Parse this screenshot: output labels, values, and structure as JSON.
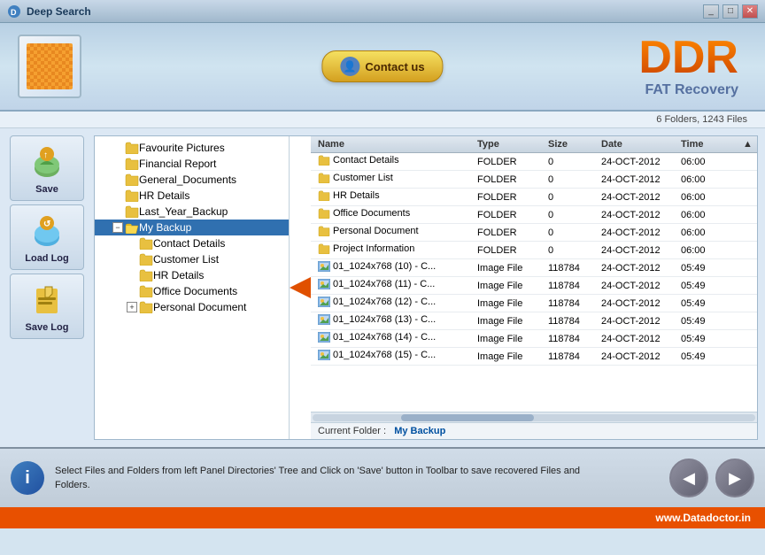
{
  "window": {
    "title": "Deep Search"
  },
  "header": {
    "contact_btn": "Contact us",
    "brand_ddr": "DDR",
    "brand_sub": "FAT Recovery"
  },
  "info_bar": {
    "text": "6 Folders, 1243 Files"
  },
  "toolbar": {
    "save_label": "Save",
    "load_log_label": "Load Log",
    "save_log_label": "Save Log"
  },
  "tree": {
    "items": [
      {
        "label": "Favourite Pictures",
        "indent": 1,
        "expanded": false
      },
      {
        "label": "Financial Report",
        "indent": 1,
        "expanded": false
      },
      {
        "label": "General_Documents",
        "indent": 1,
        "expanded": false
      },
      {
        "label": "HR Details",
        "indent": 1,
        "expanded": false
      },
      {
        "label": "Last_Year_Backup",
        "indent": 1,
        "expanded": false
      },
      {
        "label": "My Backup",
        "indent": 1,
        "expanded": true,
        "selected": true
      },
      {
        "label": "Contact Details",
        "indent": 2
      },
      {
        "label": "Customer List",
        "indent": 2
      },
      {
        "label": "HR Details",
        "indent": 2
      },
      {
        "label": "Office Documents",
        "indent": 2
      },
      {
        "label": "Personal Document",
        "indent": 2,
        "has_expand": true
      }
    ]
  },
  "file_list": {
    "columns": [
      "Name",
      "Type",
      "Size",
      "Date",
      "Time"
    ],
    "rows": [
      {
        "name": "Contact Details",
        "type": "FOLDER",
        "size": "0",
        "date": "24-OCT-2012",
        "time": "06:00",
        "is_folder": true
      },
      {
        "name": "Customer List",
        "type": "FOLDER",
        "size": "0",
        "date": "24-OCT-2012",
        "time": "06:00",
        "is_folder": true
      },
      {
        "name": "HR Details",
        "type": "FOLDER",
        "size": "0",
        "date": "24-OCT-2012",
        "time": "06:00",
        "is_folder": true
      },
      {
        "name": "Office Documents",
        "type": "FOLDER",
        "size": "0",
        "date": "24-OCT-2012",
        "time": "06:00",
        "is_folder": true
      },
      {
        "name": "Personal Document",
        "type": "FOLDER",
        "size": "0",
        "date": "24-OCT-2012",
        "time": "06:00",
        "is_folder": true
      },
      {
        "name": "Project Information",
        "type": "FOLDER",
        "size": "0",
        "date": "24-OCT-2012",
        "time": "06:00",
        "is_folder": true
      },
      {
        "name": "01_1024x768 (10) - C...",
        "type": "Image File",
        "size": "118784",
        "date": "24-OCT-2012",
        "time": "05:49",
        "is_folder": false
      },
      {
        "name": "01_1024x768 (11) - C...",
        "type": "Image File",
        "size": "118784",
        "date": "24-OCT-2012",
        "time": "05:49",
        "is_folder": false
      },
      {
        "name": "01_1024x768 (12) - C...",
        "type": "Image File",
        "size": "118784",
        "date": "24-OCT-2012",
        "time": "05:49",
        "is_folder": false
      },
      {
        "name": "01_1024x768 (13) - C...",
        "type": "Image File",
        "size": "118784",
        "date": "24-OCT-2012",
        "time": "05:49",
        "is_folder": false
      },
      {
        "name": "01_1024x768 (14) - C...",
        "type": "Image File",
        "size": "118784",
        "date": "24-OCT-2012",
        "time": "05:49",
        "is_folder": false
      },
      {
        "name": "01_1024x768 (15) - C...",
        "type": "Image File",
        "size": "118784",
        "date": "24-OCT-2012",
        "time": "05:49",
        "is_folder": false
      }
    ]
  },
  "current_folder": {
    "label": "Current Folder :",
    "value": "My Backup"
  },
  "status": {
    "text_line1": "Select Files and Folders from left Panel Directories' Tree and Click on 'Save' button in Toolbar to save recovered Files and",
    "text_line2": "Folders."
  },
  "footer": {
    "url": "www.Datadoctor.in"
  }
}
